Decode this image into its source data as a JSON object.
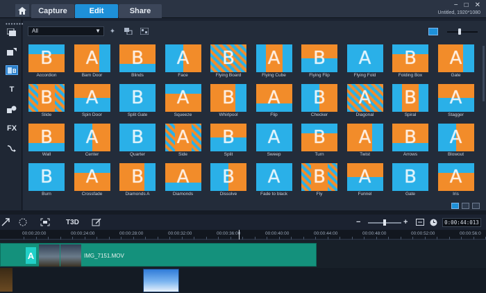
{
  "header": {
    "tabs": [
      {
        "label": "Capture"
      },
      {
        "label": "Edit"
      },
      {
        "label": "Share"
      }
    ],
    "active_tab": "Edit",
    "project_info": "Untitled, 1920*1080",
    "window_controls": [
      "minimize-icon",
      "maximize-icon",
      "close-icon"
    ]
  },
  "sidebar": {
    "items": [
      {
        "icon": "media-icon"
      },
      {
        "icon": "instant-project-icon"
      },
      {
        "icon": "transition-icon",
        "active": true
      },
      {
        "icon": "title-icon",
        "glyph": "T"
      },
      {
        "icon": "graphics-icon"
      },
      {
        "icon": "filter-icon",
        "glyph": "FX"
      },
      {
        "icon": "path-icon"
      }
    ]
  },
  "library": {
    "filter": {
      "selected": "All"
    },
    "transitions": [
      {
        "label": "Accordion"
      },
      {
        "label": "Barn Door"
      },
      {
        "label": "Blinds"
      },
      {
        "label": "Face"
      },
      {
        "label": "Flying Board"
      },
      {
        "label": "Flying Cube"
      },
      {
        "label": "Flying Flip"
      },
      {
        "label": "Flying Fold"
      },
      {
        "label": "Folding Box"
      },
      {
        "label": "Gate"
      },
      {
        "label": "Slide"
      },
      {
        "label": "Spin Door"
      },
      {
        "label": "Split Gate"
      },
      {
        "label": "Squeeze"
      },
      {
        "label": "Whirlpool"
      },
      {
        "label": "Flip"
      },
      {
        "label": "Checker"
      },
      {
        "label": "Diagonal"
      },
      {
        "label": "Spiral"
      },
      {
        "label": "Stagger"
      },
      {
        "label": "Wall"
      },
      {
        "label": "Center"
      },
      {
        "label": "Quarter"
      },
      {
        "label": "Side"
      },
      {
        "label": "Split"
      },
      {
        "label": "Sweep"
      },
      {
        "label": "Turn"
      },
      {
        "label": "Twist"
      },
      {
        "label": "Arrows"
      },
      {
        "label": "Blowout"
      },
      {
        "label": "Burn"
      },
      {
        "label": "Crossfade"
      },
      {
        "label": "Diamonds A"
      },
      {
        "label": "Diamonds"
      },
      {
        "label": "Dissolve"
      },
      {
        "label": "Fade to black"
      },
      {
        "label": "Fly"
      },
      {
        "label": "Funnel"
      },
      {
        "label": "Gate"
      },
      {
        "label": "Iris"
      }
    ]
  },
  "timeline": {
    "toolbar": {
      "title_3d_label": "T3D",
      "timecode": "0:00:44:013"
    },
    "ruler": [
      "00:00:20:00",
      "00:00:24:00",
      "00:00:28:00",
      "00:00:32:00",
      "00:00:36:00",
      "00:00:40:00",
      "00:00:44:00",
      "00:00:48:00",
      "00:00:52:00",
      "00:00:56:0"
    ],
    "video_clip": {
      "name": "IMG_7151.MOV",
      "transition_glyph": "A"
    }
  },
  "colors": {
    "accent": "#1e90d8",
    "thumb_orange": "#f28c2a",
    "thumb_blue": "#2ab0e8",
    "clip_teal": "#14917c"
  }
}
